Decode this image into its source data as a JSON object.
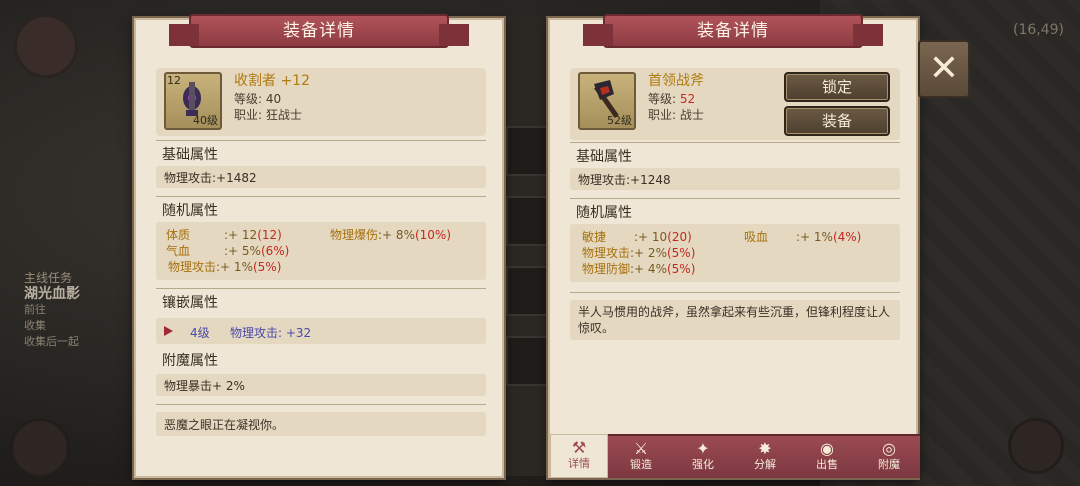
{
  "background": {
    "coords": "(16,49)",
    "quest_heading": "主线任务",
    "quest_name": "湖光血影",
    "quest_line1": "前往",
    "quest_line2": "收集",
    "quest_line3": "收集后一起"
  },
  "left_panel": {
    "title": "装备详情",
    "item": {
      "name": "收割者 +12",
      "enhance_badge": "12",
      "level_badge": "40级",
      "level_label": "等级:",
      "level_value": "40",
      "class_label": "职业:",
      "class_value": "狂战士"
    },
    "base_title": "基础属性",
    "base_stat": "物理攻击:+1482",
    "random_title": "随机属性",
    "random_stats": [
      {
        "name": "体质",
        "value": ":+ 12",
        "extra": "(12)"
      },
      {
        "name": "物理爆伤",
        "value": ":+ 8%",
        "extra": "(10%)"
      },
      {
        "name": "气血",
        "value": ":+ 5%",
        "extra": "(6%)"
      },
      {
        "name": "物理攻击",
        "value": ":+ 1%",
        "extra": "(5%)"
      }
    ],
    "inlay_title": "镶嵌属性",
    "inlay_level": "4级",
    "inlay_stat": "物理攻击: +32",
    "enchant_title": "附魔属性",
    "enchant_stat": "物理暴击+ 2%",
    "description": "恶魔之眼正在凝视你。"
  },
  "right_panel": {
    "title": "装备详情",
    "item": {
      "name": "首领战斧",
      "level_badge": "52级",
      "level_label": "等级:",
      "level_value": "52",
      "class_label": "职业:",
      "class_value": "战士"
    },
    "lock_label": "锁定",
    "equip_label": "装备",
    "base_title": "基础属性",
    "base_stat": "物理攻击:+1248",
    "random_title": "随机属性",
    "random_stats": [
      {
        "name": "敏捷",
        "value": ":+ 10",
        "extra": "(20)"
      },
      {
        "name": "吸血",
        "value": ":+ 1%",
        "extra": "(4%)"
      },
      {
        "name": "物理攻击",
        "value": ":+ 2%",
        "extra": "(5%)"
      },
      {
        "name": "物理防御",
        "value": ":+ 4%",
        "extra": "(5%)"
      }
    ],
    "description": "半人马惯用的战斧，虽然拿起来有些沉重，但锋利程度让人惊叹。",
    "tabs": [
      {
        "label": "详情",
        "icon": "⚒"
      },
      {
        "label": "锻造",
        "icon": "⚔"
      },
      {
        "label": "强化",
        "icon": "✦"
      },
      {
        "label": "分解",
        "icon": "✸"
      },
      {
        "label": "出售",
        "icon": "◉"
      },
      {
        "label": "附魔",
        "icon": "◎"
      }
    ]
  },
  "close_label": "✕",
  "colors": {
    "panel_bg": "#efe6d5",
    "ribbon": "#9b4a52",
    "item_name": "#b07a10",
    "highlight_red": "#c22a1f",
    "inlay_blue": "#4a4aa8"
  }
}
